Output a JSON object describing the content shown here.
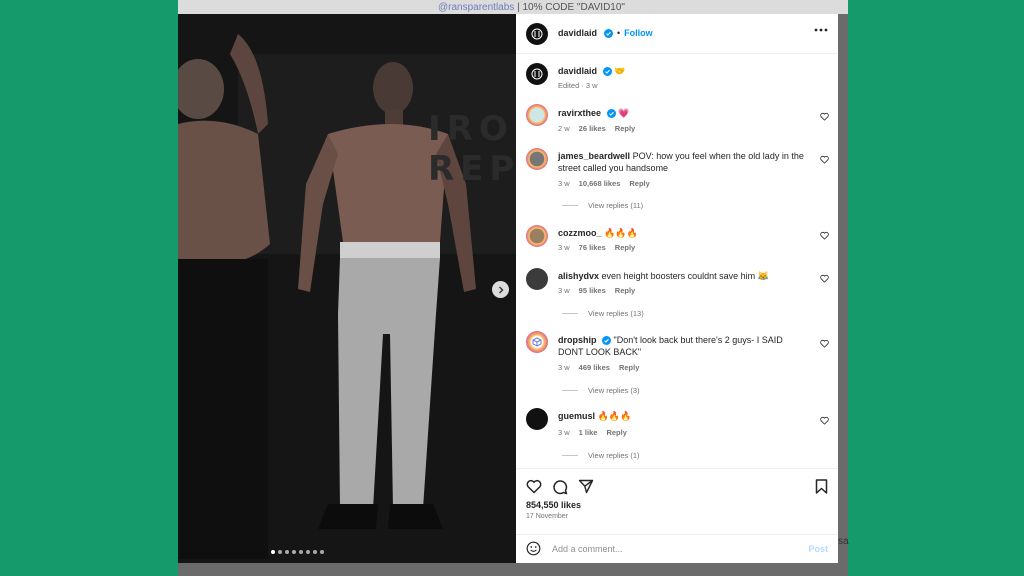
{
  "background_text": {
    "link": "@ransparentlabs",
    "code": " | 10% CODE \"DAVID10\"",
    "right_fragment": "sa"
  },
  "photo": {
    "sign_text": "IRON REP",
    "slide_count": 8,
    "active_slide": 1
  },
  "post": {
    "author": "davidlaid",
    "follow_label": "Follow",
    "caption_emoji": "🤝",
    "caption_meta": "Edited · 3 w",
    "likes": "854,550 likes",
    "date": "17 November",
    "add_comment_placeholder": "Add a comment...",
    "post_label": "Post"
  },
  "comments": [
    {
      "user": "ravirxthee",
      "verified": true,
      "text": "💗",
      "age": "2 w",
      "likes": "26 likes",
      "reply": "Reply",
      "view_replies": ""
    },
    {
      "user": "james_beardwell",
      "verified": false,
      "text": "POV: how you feel when the old lady in the street called you handsome",
      "age": "3 w",
      "likes": "10,668 likes",
      "reply": "Reply",
      "view_replies": "View replies (11)"
    },
    {
      "user": "cozzmoo_",
      "verified": false,
      "text": "🔥🔥🔥",
      "age": "3 w",
      "likes": "76 likes",
      "reply": "Reply",
      "view_replies": ""
    },
    {
      "user": "alishydvx",
      "verified": false,
      "text": "even height boosters couldnt save him 😹",
      "age": "3 w",
      "likes": "95 likes",
      "reply": "Reply",
      "view_replies": "View replies (13)"
    },
    {
      "user": "dropship",
      "verified": true,
      "text": "\"Don't look back but there's 2 guys- I SAID DONT LOOK BACK\"",
      "age": "3 w",
      "likes": "469 likes",
      "reply": "Reply",
      "view_replies": "View replies (3)"
    },
    {
      "user": "guemusl",
      "verified": false,
      "text": "🔥🔥🔥",
      "age": "3 w",
      "likes": "1 like",
      "reply": "Reply",
      "view_replies": "View replies (1)"
    }
  ],
  "colors": {
    "background": "#159a6b",
    "accent": "#0095f6",
    "muted": "#737373"
  }
}
